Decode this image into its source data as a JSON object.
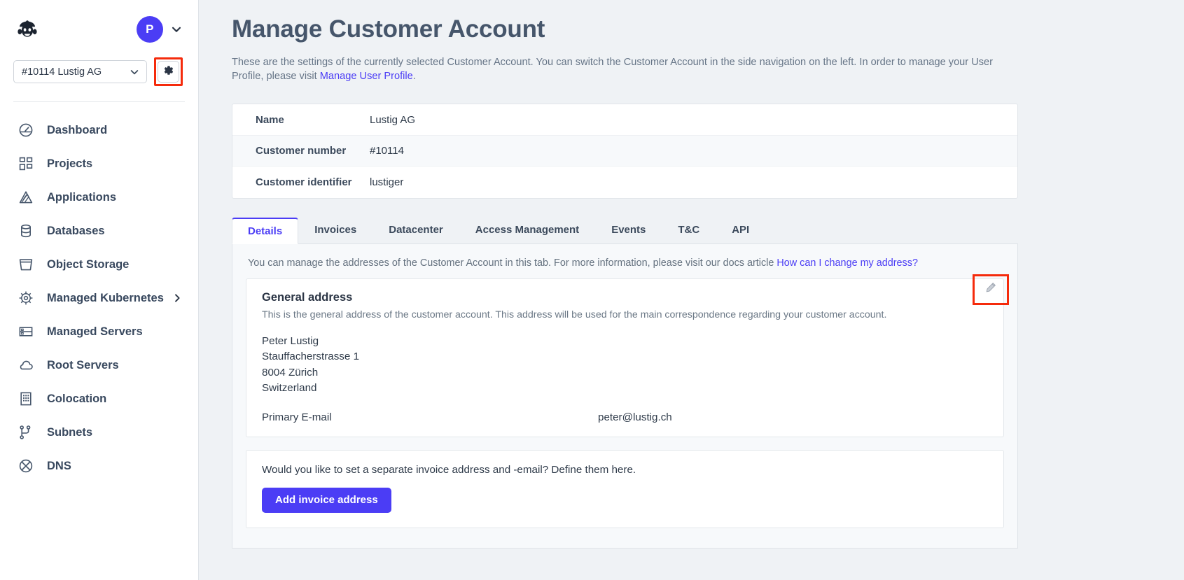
{
  "sidebar": {
    "logo_name": "app-logo-face",
    "user": {
      "avatar_initial": "P"
    },
    "account_select": {
      "value": "#10114 Lustig AG"
    },
    "settings_button_name": "gear-icon",
    "items": [
      {
        "label": "Dashboard",
        "icon": "gauge-icon",
        "has_submenu": false
      },
      {
        "label": "Projects",
        "icon": "grid-icon",
        "has_submenu": false
      },
      {
        "label": "Applications",
        "icon": "triangle-icon",
        "has_submenu": false
      },
      {
        "label": "Databases",
        "icon": "database-icon",
        "has_submenu": false
      },
      {
        "label": "Object Storage",
        "icon": "bucket-icon",
        "has_submenu": false
      },
      {
        "label": "Managed Kubernetes",
        "icon": "helm-wheel-icon",
        "has_submenu": true
      },
      {
        "label": "Managed Servers",
        "icon": "server-icon",
        "has_submenu": false
      },
      {
        "label": "Root Servers",
        "icon": "cloud-icon",
        "has_submenu": false
      },
      {
        "label": "Colocation",
        "icon": "building-icon",
        "has_submenu": false
      },
      {
        "label": "Subnets",
        "icon": "network-icon",
        "has_submenu": false
      },
      {
        "label": "DNS",
        "icon": "globe-slash-icon",
        "has_submenu": false
      }
    ]
  },
  "main": {
    "title": "Manage Customer Account",
    "description_before_link": "These are the settings of the currently selected Customer Account. You can switch the Customer Account in the side navigation on the left. In order to manage your User Profile, please visit ",
    "description_link": "Manage User Profile",
    "description_after_link": ".",
    "info_rows": [
      {
        "key": "Name",
        "value": "Lustig AG"
      },
      {
        "key": "Customer number",
        "value": "#10114"
      },
      {
        "key": "Customer identifier",
        "value": "lustiger"
      }
    ],
    "tabs": [
      {
        "label": "Details",
        "active": true
      },
      {
        "label": "Invoices",
        "active": false
      },
      {
        "label": "Datacenter",
        "active": false
      },
      {
        "label": "Access Management",
        "active": false
      },
      {
        "label": "Events",
        "active": false
      },
      {
        "label": "T&C",
        "active": false
      },
      {
        "label": "API",
        "active": false
      }
    ],
    "panel": {
      "description_before_link": "You can manage the addresses of the Customer Account in this tab. For more information, please visit our docs article ",
      "description_link": "How can I change my address?",
      "general_address": {
        "title": "General address",
        "subtitle": "This is the general address of the customer account. This address will be used for the main correspondence regarding your customer account.",
        "lines": [
          "Peter Lustig",
          "Stauffacherstrasse 1",
          "8004 Zürich",
          "Switzerland"
        ],
        "email_label": "Primary E-mail",
        "email_value": "peter@lustig.ch",
        "edit_icon": "pencil-icon"
      },
      "invoice_section": {
        "text": "Would you like to set a separate invoice address and -email? Define them here.",
        "button_label": "Add invoice address"
      }
    }
  },
  "colors": {
    "accent": "#4b3df5",
    "highlight": "#f52b0c",
    "page_bg": "#eff2f5",
    "text": "#38485e"
  }
}
